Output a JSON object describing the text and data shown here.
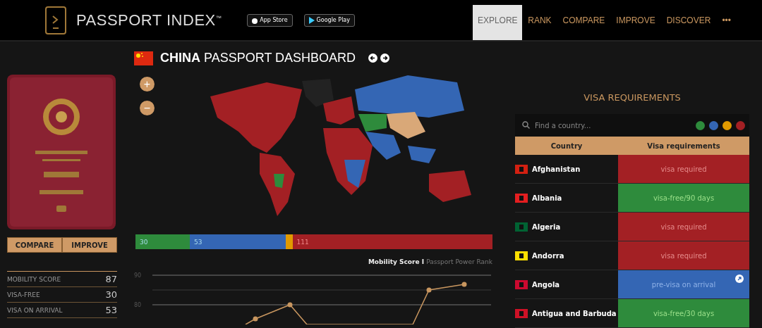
{
  "header": {
    "logo": "PASSPORT INDEX$^{™}$",
    "stores": [
      "App Store",
      "Google Play"
    ],
    "nav": [
      {
        "label": "EXPLORE",
        "selected": true
      },
      {
        "label": "RANK",
        "selected": false
      },
      {
        "label": "COMPARE",
        "selected": false
      },
      {
        "label": "IMPROVE",
        "selected": false
      },
      {
        "label": "DISCOVER",
        "selected": false
      },
      {
        "label": "•••",
        "selected": false
      }
    ]
  },
  "passport": {
    "kind": "picture",
    "buttons": [
      "COMPARE",
      "IMPROVE"
    ],
    "stats": [
      {
        "label": "MOBILITY SCORE",
        "value": "87"
      },
      {
        "label": "VISA-FREE",
        "value": "30"
      },
      {
        "label": "VISA ON ARRIVAL",
        "value": "53"
      }
    ]
  },
  "dashboard": {
    "country": "CHINA",
    "title": "PASSPORT DASHBOARD",
    "zoom": [
      "+",
      "−"
    ],
    "bar": [
      {
        "label": "30",
        "level": 0.152,
        "color": "#2e8b3c"
      },
      {
        "label": "53",
        "level": 0.268,
        "color": "#3466b4"
      },
      {
        "level": 0.02,
        "color": "#e09a00"
      },
      {
        "label": "111",
        "level": 0.56,
        "color": "#a32024"
      }
    ],
    "chart_legend": {
      "active": "Mobility Score",
      "separator": "I",
      "inactive": "Passport Power Rank"
    },
    "trend": {
      "axis_labels": [
        "90",
        "80"
      ]
    }
  },
  "visa": {
    "title": "VISA REQUIREMENTS",
    "search": {
      "placeholder": "Find a country..."
    },
    "filters": [
      {
        "color": "#2e8b3c"
      },
      {
        "color": "#3466b4"
      },
      {
        "color": "#e09a00"
      },
      {
        "color": "#a32024"
      }
    ],
    "columns": [
      "Country",
      "Visa requirements"
    ],
    "rows": [
      {
        "country": "Afghanistan",
        "color": "#d32011",
        "status": "visa required",
        "kind": "required",
        "link": false
      },
      {
        "country": "Albania",
        "color": "#e41e20",
        "status": "visa-free/90 days",
        "kind": "free",
        "link": false
      },
      {
        "country": "Algeria",
        "color": "#006233",
        "status": "visa required",
        "kind": "required",
        "link": false
      },
      {
        "country": "Andorra",
        "color": "#fedf00",
        "status": "visa required",
        "kind": "required",
        "link": false
      },
      {
        "country": "Angola",
        "color": "#cc092f",
        "status": "pre-visa on arrival",
        "kind": "arrival",
        "link": true
      },
      {
        "country": "Antigua and Barbuda",
        "color": "#ce1126",
        "status": "visa-free/30 days",
        "kind": "free",
        "link": false
      }
    ]
  }
}
